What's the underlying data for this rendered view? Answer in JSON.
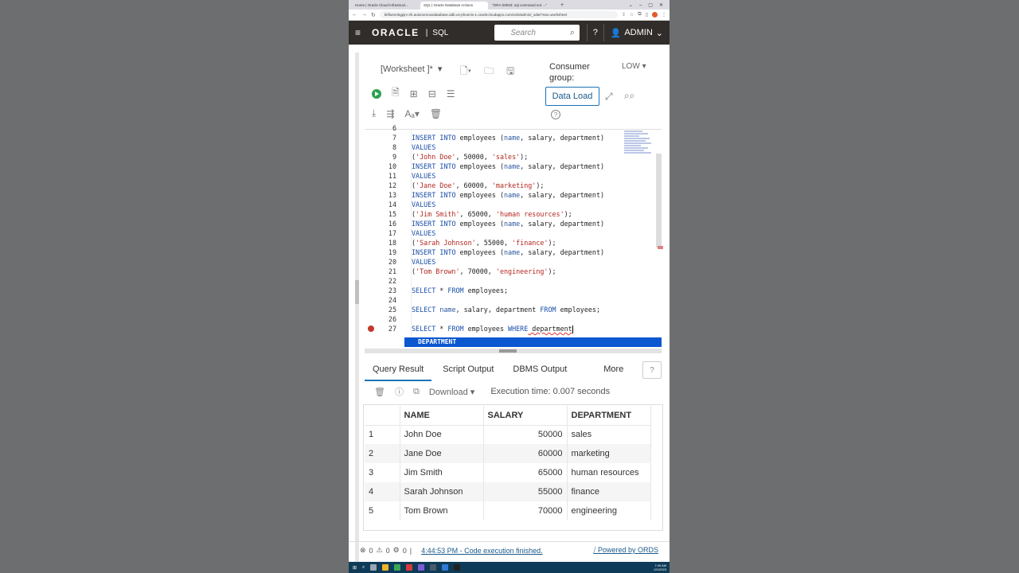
{
  "browser": {
    "tabs": [
      "Home | Oracle Cloud Infrastruct...",
      "SQL | Oracle Database Actions",
      "\"ORA-00933: sql command not ...\""
    ],
    "url": "bkfluennkgpjrv-2h.autonomousdatabase.adb.us-phoenix-1.oraclecloudapps.com/ords/admin/_sdw/?nav=worksheet"
  },
  "header": {
    "logo": "ORACLE",
    "separator": "|",
    "app": "SQL",
    "search_placeholder": "Search",
    "user": "ADMIN"
  },
  "worksheet": {
    "name": "[Worksheet ]*",
    "consumer_group_label": "Consumer group:",
    "consumer_group_value": "LOW",
    "data_load": "Data Load"
  },
  "editor": {
    "line_numbers": [
      "6",
      "7",
      "8",
      "9",
      "10",
      "11",
      "12",
      "13",
      "14",
      "15",
      "16",
      "17",
      "18",
      "19",
      "20",
      "21",
      "22",
      "23",
      "24",
      "25",
      "26",
      "27"
    ],
    "insert_stmt": [
      "INSERT",
      " ",
      "INTO",
      " employees (",
      "name",
      ", salary, department)"
    ],
    "values_kw": "VALUES",
    "rows": [
      {
        "open": "(",
        "name": "'John Doe'",
        "mid": ", 50000, ",
        "dept": "'sales'",
        "close": ");"
      },
      {
        "open": "(",
        "name": "'Jane Doe'",
        "mid": ", 60000, ",
        "dept": "'marketing'",
        "close": ");"
      },
      {
        "open": "(",
        "name": "'Jim Smith'",
        "mid": ", 65000, ",
        "dept": "'human resources'",
        "close": ");"
      },
      {
        "open": "(",
        "name": "'Sarah Johnson'",
        "mid": ", 55000, ",
        "dept": "'finance'",
        "close": ");"
      },
      {
        "open": "(",
        "name": "'Tom Brown'",
        "mid": ", 70000, ",
        "dept": "'engineering'",
        "close": ");"
      }
    ],
    "select1": [
      "SELECT",
      " * ",
      "FROM",
      " employees;"
    ],
    "select2": [
      "SELECT",
      " ",
      "name",
      ", salary, department ",
      "FROM",
      " employees;"
    ],
    "select3": [
      "SELECT",
      " * ",
      "FROM",
      " employees ",
      "WHERE",
      " department"
    ],
    "autocomplete": "DEPARTMENT"
  },
  "results": {
    "tabs": [
      "Query Result",
      "Script Output",
      "DBMS Output",
      "More"
    ],
    "download": "Download",
    "execution_time": "Execution time: 0.007 seconds",
    "columns": [
      "NAME",
      "SALARY",
      "DEPARTMENT"
    ],
    "rows": [
      {
        "n": "1",
        "name": "John Doe",
        "salary": "50000",
        "dept": "sales"
      },
      {
        "n": "2",
        "name": "Jane Doe",
        "salary": "60000",
        "dept": "marketing"
      },
      {
        "n": "3",
        "name": "Jim Smith",
        "salary": "65000",
        "dept": "human resources"
      },
      {
        "n": "4",
        "name": "Sarah Johnson",
        "salary": "55000",
        "dept": "finance"
      },
      {
        "n": "5",
        "name": "Tom Brown",
        "salary": "70000",
        "dept": "engineering"
      }
    ]
  },
  "status": {
    "errors": "0",
    "warnings": "0",
    "settings_count": "0",
    "divider": "|",
    "message": "4:44:53 PM - Code execution finished.",
    "ords": "Powered by ORDS"
  },
  "taskbar": {
    "time": "7:45 AM",
    "date": "2/1/2023"
  },
  "colors": {
    "header_bg": "#312d2a",
    "accent": "#1a73b8",
    "keyword": "#1a4ea8",
    "string": "#b3261e",
    "run": "#2ca14f"
  }
}
